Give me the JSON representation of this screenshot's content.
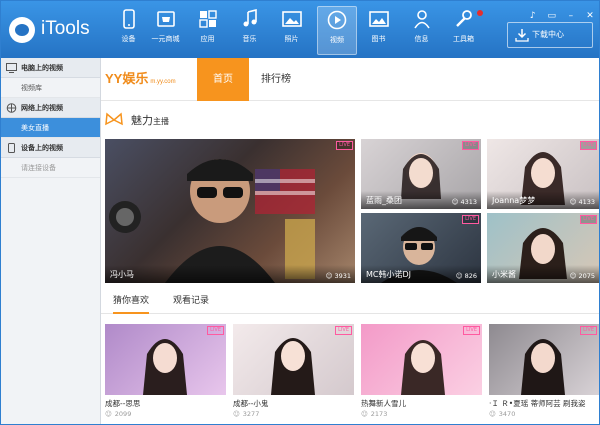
{
  "app": {
    "name": "iTools"
  },
  "nav": [
    {
      "label": "设备",
      "icon": "phone-icon"
    },
    {
      "label": "一元商城",
      "icon": "shopping-cart-icon"
    },
    {
      "label": "应用",
      "icon": "apps-grid-icon"
    },
    {
      "label": "音乐",
      "icon": "music-note-icon"
    },
    {
      "label": "照片",
      "icon": "photo-icon"
    },
    {
      "label": "视频",
      "icon": "video-play-icon",
      "active": true
    },
    {
      "label": "图书",
      "icon": "book-image-icon"
    },
    {
      "label": "信息",
      "icon": "person-icon"
    },
    {
      "label": "工具箱",
      "icon": "wrench-icon"
    }
  ],
  "window_controls": [
    "♪",
    "▭",
    "–",
    "✕"
  ],
  "download_label": "下载中心",
  "sidebar": {
    "groups": [
      {
        "label": "电脑上的视频",
        "icon": "monitor-icon",
        "items": [
          {
            "label": "视频库"
          }
        ]
      },
      {
        "label": "网络上的视频",
        "icon": "globe-icon",
        "items": [
          {
            "label": "美女直播",
            "active": true
          }
        ]
      },
      {
        "label": "设备上的视频",
        "icon": "device-icon",
        "items": [
          {
            "label": "请连接设备",
            "muted": true
          }
        ]
      }
    ]
  },
  "yy": {
    "logo": "YY娱乐",
    "logo_sub": "m.yy.com",
    "tabs": [
      "首页",
      "排行榜"
    ],
    "section_title": "魅力",
    "section_sub": "主播",
    "live_badge": "LIVE"
  },
  "featured": [
    {
      "name": "冯小马",
      "viewers": "3931"
    },
    {
      "name": "蓝雨_桑团",
      "viewers": "4313"
    },
    {
      "name": "Joanna梦梦",
      "viewers": "4133"
    },
    {
      "name": "MC韩小诺DJ",
      "viewers": "826"
    },
    {
      "name": "小米酱",
      "viewers": "2075"
    }
  ],
  "like_tabs": [
    "猜你喜欢",
    "观看记录"
  ],
  "recommend": [
    {
      "name": "成都--思思",
      "viewers": "2099"
    },
    {
      "name": "成都--小鬼",
      "viewers": "3277"
    },
    {
      "name": "热舞新人雪儿",
      "viewers": "2173"
    },
    {
      "name": "·Ｉ Ｒ•夏瑶 蒂师阿芸 刷我姿",
      "viewers": "3470"
    }
  ],
  "colors": {
    "topbar": "#2a7bd0",
    "accent": "#f7941e",
    "live": "#ff5aa0",
    "sidebar_active": "#3c8fdc"
  }
}
